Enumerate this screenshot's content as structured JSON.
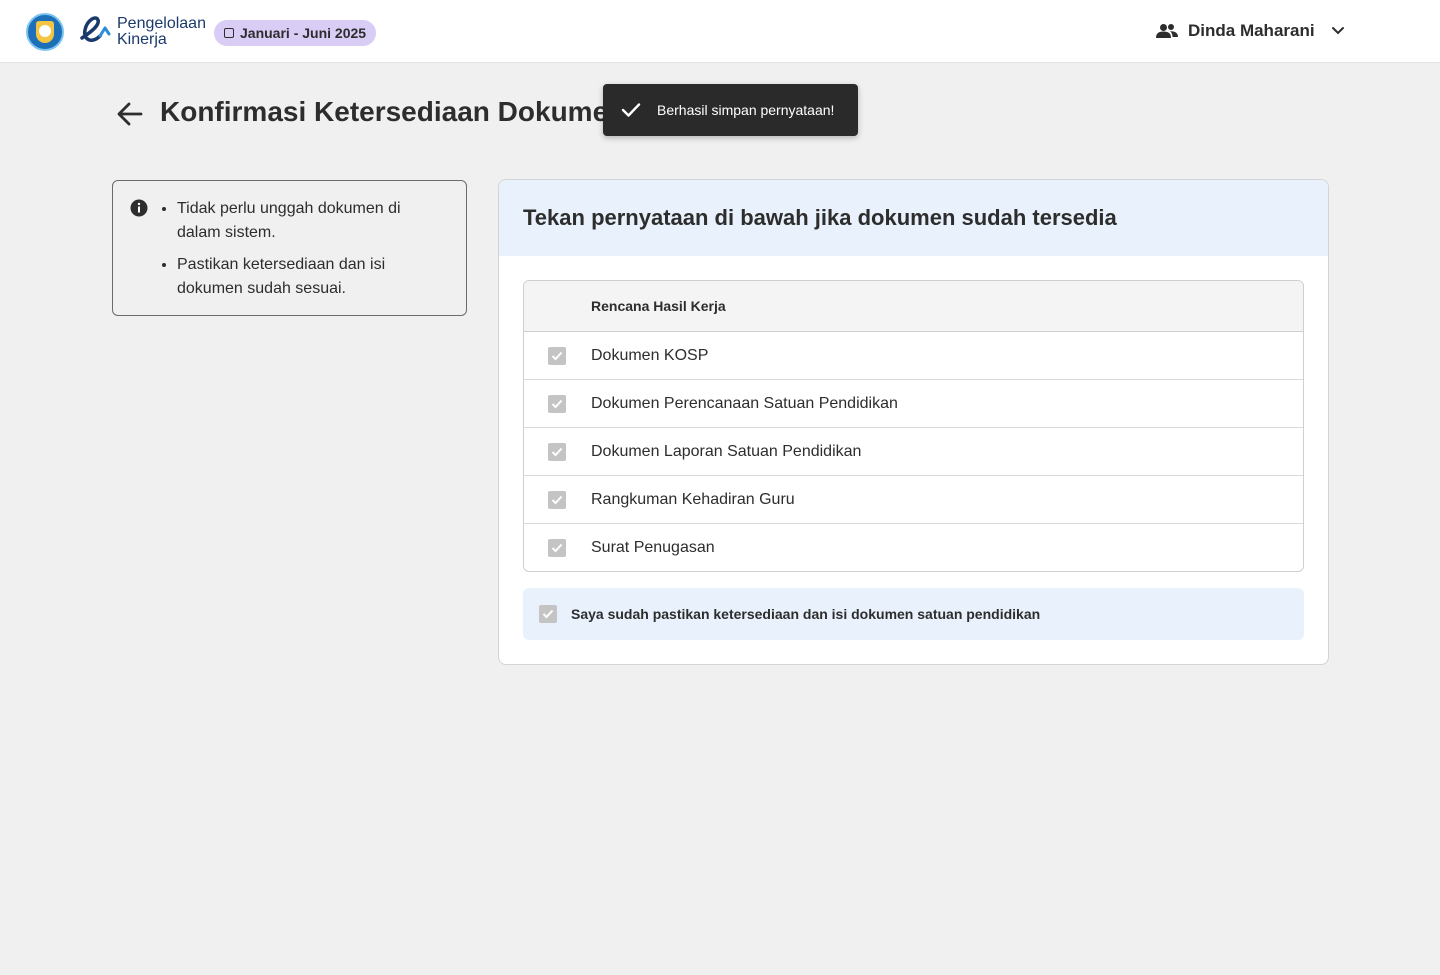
{
  "header": {
    "brand_line1": "Pengelolaan",
    "brand_line2": "Kinerja",
    "period": "Januari - Juni 2025",
    "user_name": "Dinda Maharani"
  },
  "page": {
    "title": "Konfirmasi Ketersediaan Dokume"
  },
  "toast": {
    "message": "Berhasil simpan pernyataan!"
  },
  "info": {
    "items": [
      "Tidak perlu unggah dokumen di dalam sistem.",
      "Pastikan ketersediaan dan isi dokumen sudah sesuai."
    ]
  },
  "card": {
    "heading": "Tekan pernyataan di bawah jika dokumen sudah tersedia",
    "table_header": "Rencana Hasil Kerja",
    "documents": [
      "Dokumen KOSP",
      "Dokumen Perencanaan Satuan Pendidikan",
      "Dokumen Laporan Satuan Pendidikan",
      "Rangkuman Kehadiran Guru",
      "Surat Penugasan"
    ],
    "confirm_label": "Saya sudah pastikan ketersediaan dan isi dokumen satuan pendidikan"
  },
  "colors": {
    "header_bg": "#ffffff",
    "page_bg": "#eff0ef",
    "period_badge": "#d9ccf5",
    "card_head_bg": "#e9f2fc",
    "toast_bg": "#2a2a2a",
    "checkbox_disabled": "#c4c4c4"
  }
}
